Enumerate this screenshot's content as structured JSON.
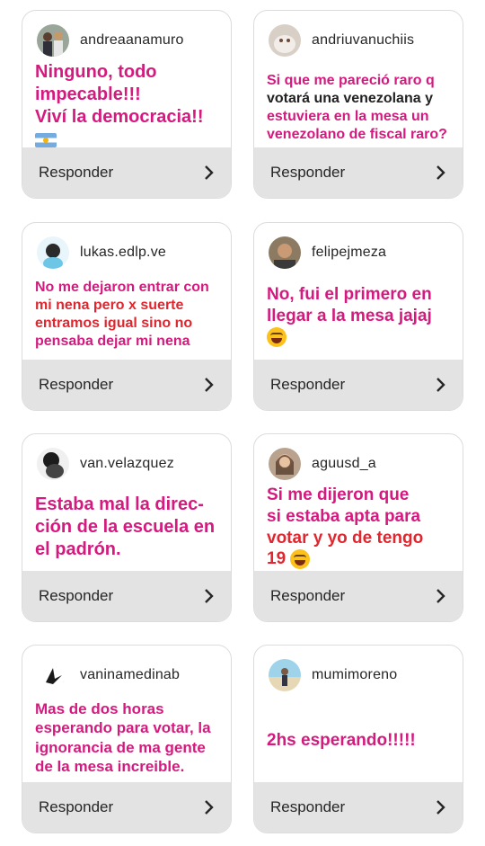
{
  "reply_label": "Responder",
  "colors": {
    "magenta": "#d41a7e",
    "red": "#e0262e",
    "footer_bg": "#e3e3e3"
  },
  "cards": [
    {
      "username": "andreaanamuro",
      "avatar": "group-photo-avatar",
      "lines": [
        "Ninguno, todo",
        "impecable!!!",
        "Viví la democracia!!"
      ],
      "trailing": "argentina-flag-emoji"
    },
    {
      "username": "andriuvanuchiis",
      "avatar": "cat-photo-avatar",
      "lines": [
        "Si que me pareció raro q",
        "votará una venezolana y",
        "estuviera en la mesa un",
        "venezolano de fiscal raro?"
      ]
    },
    {
      "username": "lukas.edlp.ve",
      "avatar": "illustration-avatar",
      "lines": [
        "No me dejaron entrar con",
        "mi nena pero x suerte",
        "entramos igual sino no",
        "pensaba dejar mi nena"
      ]
    },
    {
      "username": "felipejmeza",
      "avatar": "man-photo-avatar",
      "lines": [
        "No, fui el primero en",
        "llegar a la mesa jajaj"
      ],
      "trailing": "grinning-emoji"
    },
    {
      "username": "van.velazquez",
      "avatar": "bw-photo-avatar",
      "lines": [
        "Estaba mal la direc-",
        "ción de la escuela en",
        "el padrón."
      ]
    },
    {
      "username": "aguusd_a",
      "avatar": "woman-photo-avatar",
      "lines": [
        "Si me dijeron que",
        "si estaba apta para",
        "votar y yo de tengo",
        "19"
      ],
      "trailing": "grinning-emoji"
    },
    {
      "username": "vaninamedinab",
      "avatar": "logo-avatar",
      "lines": [
        "Mas de dos horas",
        "esperando para votar, la",
        "ignorancia de ma gente",
        "de la mesa increible."
      ]
    },
    {
      "username": "mumimoreno",
      "avatar": "beach-photo-avatar",
      "lines": [
        "2hs esperando!!!!!"
      ]
    }
  ]
}
